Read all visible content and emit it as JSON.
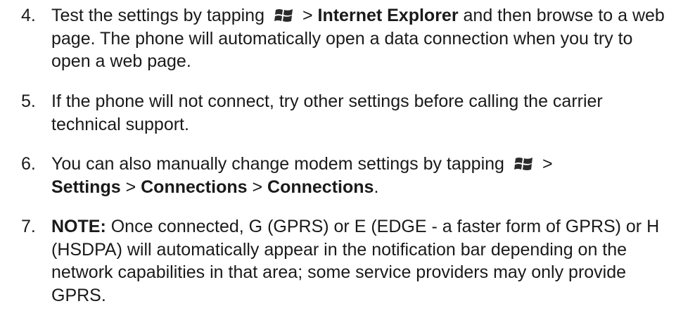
{
  "document": {
    "steps": [
      {
        "number": "4.",
        "part1": "Test the settings by tapping",
        "part2": "> ",
        "bold1": "Internet Explorer",
        "part3": " and then browse to a web page. The phone will automatically open a data connection when you try to open a web page.",
        "icon": "windows-start-icon"
      },
      {
        "number": "5.",
        "text": "If the phone will not connect, try other settings before calling the carrier technical support."
      },
      {
        "number": "6.",
        "part1": "You can also manually change modem settings by tapping",
        "part2": "> ",
        "bold1": "Settings",
        "sep1": " > ",
        "bold2": "Connections",
        "sep2": " > ",
        "bold3": "Connections",
        "end": ".",
        "icon": "windows-start-icon"
      },
      {
        "number": "7.",
        "bold1": "NOTE:",
        "text": " Once connected, G (GPRS) or E (EDGE - a faster form of GPRS) or H (HSDPA) will automatically appear in the notification bar depending on the network capabilities in that area; some service providers may only provide GPRS."
      }
    ]
  }
}
